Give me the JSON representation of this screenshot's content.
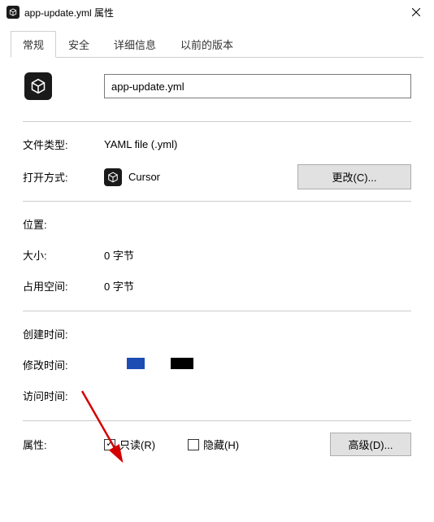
{
  "titlebar": {
    "title": "app-update.yml 属性"
  },
  "tabs": [
    {
      "label": "常规",
      "active": true
    },
    {
      "label": "安全",
      "active": false
    },
    {
      "label": "详细信息",
      "active": false
    },
    {
      "label": "以前的版本",
      "active": false
    }
  ],
  "filename": {
    "value": "app-update.yml"
  },
  "rows": {
    "filetype_label": "文件类型:",
    "filetype_value": "YAML file (.yml)",
    "openwith_label": "打开方式:",
    "openwith_value": "Cursor",
    "change_button": "更改(C)...",
    "location_label": "位置:",
    "location_value": "",
    "size_label": "大小:",
    "size_value": "0 字节",
    "sizeondisk_label": "占用空间:",
    "sizeondisk_value": "0 字节",
    "created_label": "创建时间:",
    "created_value": "",
    "modified_label": "修改时间:",
    "modified_value": "",
    "accessed_label": "访问时间:",
    "accessed_value": ""
  },
  "attributes": {
    "label": "属性:",
    "readonly_label": "只读(R)",
    "readonly_checked": true,
    "hidden_label": "隐藏(H)",
    "hidden_checked": false,
    "advanced_button": "高级(D)..."
  }
}
